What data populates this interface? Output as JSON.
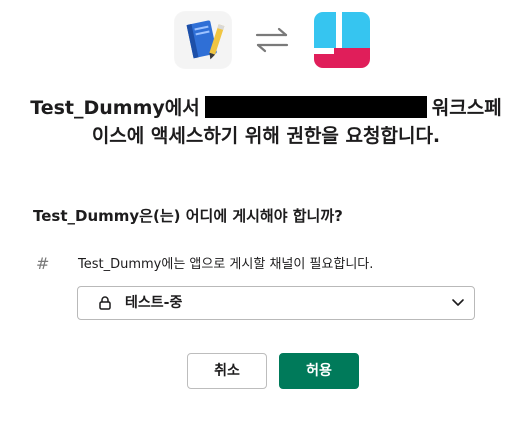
{
  "header": {
    "left_app_icon": "notebook-app-icon",
    "swap_icon": "swap-arrows-icon",
    "right_app_icon": "slack-workspace-icon"
  },
  "title": {
    "app_name_prefix": "Test_Dummy에서",
    "workspace_suffix": "워크스페",
    "line2": "이스에 액세스하기 위해 권한을 요청합니다."
  },
  "question": "Test_Dummy은(는) 어디에 게시해야 합니까?",
  "channel_hint": {
    "icon": "hash-icon",
    "text": "Test_Dummy에는 앱으로 게시할 채널이 필요합니다."
  },
  "channel_select": {
    "icon": "lock-icon",
    "selected_value": "테스트-중",
    "chevron": "chevron-down-icon"
  },
  "actions": {
    "cancel_label": "취소",
    "allow_label": "허용"
  },
  "colors": {
    "allow_button": "#007a5a",
    "text": "#1d1c1d",
    "border": "#bdbdbd",
    "slack_teal": "#36c5f0",
    "slack_red": "#e01e5a"
  }
}
